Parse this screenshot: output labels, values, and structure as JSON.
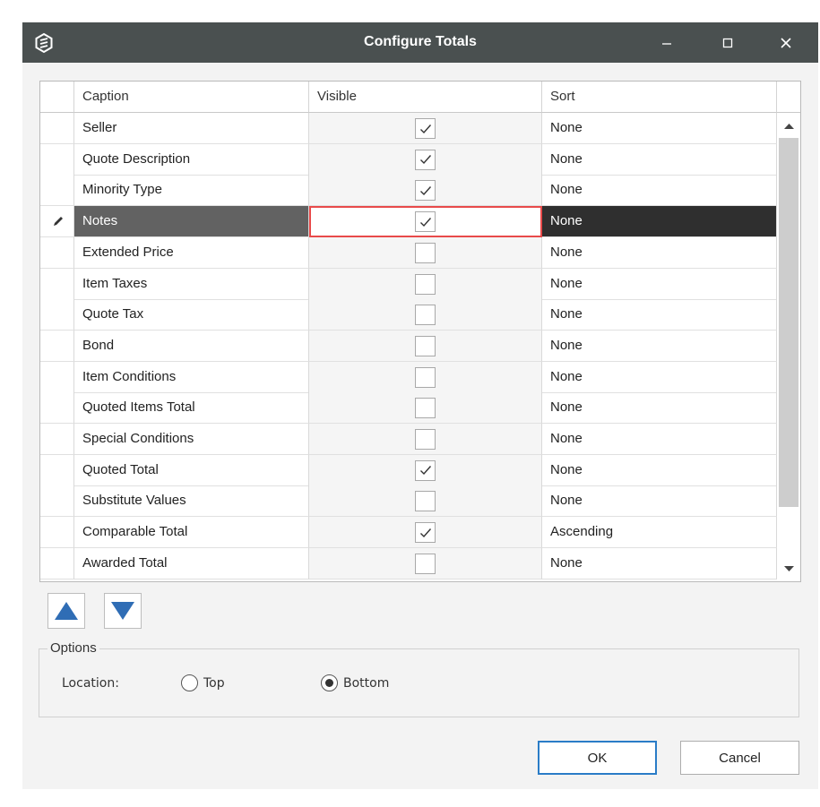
{
  "window": {
    "title": "Configure Totals",
    "icon": "app-logo-icon"
  },
  "titlebar_buttons": [
    {
      "name": "minimize-button",
      "icon": "minimize-icon"
    },
    {
      "name": "maximize-button",
      "icon": "maximize-icon"
    },
    {
      "name": "close-button",
      "icon": "close-icon"
    }
  ],
  "grid": {
    "columns": {
      "caption": "Caption",
      "visible": "Visible",
      "sort": "Sort"
    },
    "selected_row_index": 3,
    "editing_indicator_icon": "pencil-icon",
    "rows": [
      {
        "caption": "Seller",
        "visible": true,
        "sort": "None"
      },
      {
        "caption": "Quote Description",
        "visible": true,
        "sort": "None"
      },
      {
        "caption": "Minority Type",
        "visible": true,
        "sort": "None"
      },
      {
        "caption": "Notes",
        "visible": true,
        "sort": "None"
      },
      {
        "caption": "Extended Price",
        "visible": false,
        "sort": "None"
      },
      {
        "caption": "Item Taxes",
        "visible": false,
        "sort": "None"
      },
      {
        "caption": "Quote Tax",
        "visible": false,
        "sort": "None"
      },
      {
        "caption": "Bond",
        "visible": false,
        "sort": "None"
      },
      {
        "caption": "Item Conditions",
        "visible": false,
        "sort": "None"
      },
      {
        "caption": "Quoted Items Total",
        "visible": false,
        "sort": "None"
      },
      {
        "caption": "Special Conditions",
        "visible": false,
        "sort": "None"
      },
      {
        "caption": "Quoted Total",
        "visible": true,
        "sort": "None"
      },
      {
        "caption": "Substitute Values",
        "visible": false,
        "sort": "None"
      },
      {
        "caption": "Comparable Total",
        "visible": true,
        "sort": "Ascending"
      },
      {
        "caption": "Awarded Total",
        "visible": false,
        "sort": "None"
      }
    ]
  },
  "move_buttons": {
    "up_icon": "triangle-up-icon",
    "down_icon": "triangle-down-icon",
    "color": "#2f6db5"
  },
  "options": {
    "group_label": "Options",
    "location_label": "Location:",
    "location_choices": [
      "Top",
      "Bottom"
    ],
    "location_selected": "Bottom"
  },
  "footer": {
    "ok_label": "OK",
    "cancel_label": "Cancel"
  },
  "colors": {
    "titlebar": "#4a5050",
    "selected_caption_bg": "#626262",
    "selected_sort_bg": "#2f2f2f",
    "focus_outline": "#e84a4a",
    "default_button_border": "#2a7cc7"
  }
}
